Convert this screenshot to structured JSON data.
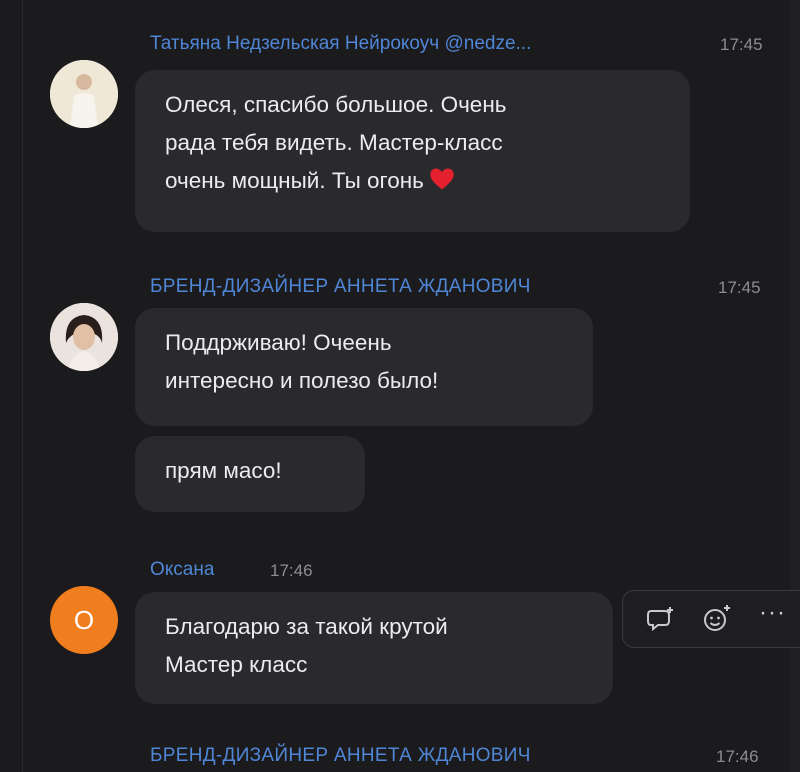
{
  "messages": [
    {
      "sender": "Татьяна Недзельская Нейрокоуч @nedze...",
      "time": "17:45",
      "avatar_icon": "user-photo-icon",
      "lines": [
        "Олеся, спасибо большое. Очень",
        "рада тебя видеть. Мастер-класс",
        "очень мощный. Ты огонь"
      ],
      "emoji": "heart-icon"
    },
    {
      "sender": "БРЕНД-ДИЗАЙНЕР АННЕТА ЖДАНОВИЧ",
      "time": "17:45",
      "avatar_icon": "user-photo-icon",
      "lines": [
        "Поддрживаю! Очеень",
        "интересно и полезо было!"
      ],
      "followup_lines": [
        "прям масо!"
      ]
    },
    {
      "sender": "Оксана",
      "time": "17:46",
      "avatar_letter": "О",
      "avatar_color": "#f07d1e",
      "lines": [
        "Благодарю за такой крутой",
        "Мастер класс"
      ]
    },
    {
      "sender": "БРЕНД-ДИЗАЙНЕР АННЕТА ЖДАНОВИЧ",
      "time": "17:46"
    }
  ],
  "toolbar": {
    "reply_icon": "reply-icon",
    "react_icon": "add-reaction-icon",
    "more_label": "···"
  },
  "colors": {
    "background": "#1b1b1d",
    "bubble": "#2a2a2d",
    "sender_name": "#4f86d6",
    "timestamp": "#8c8c92",
    "text": "#ececef"
  }
}
